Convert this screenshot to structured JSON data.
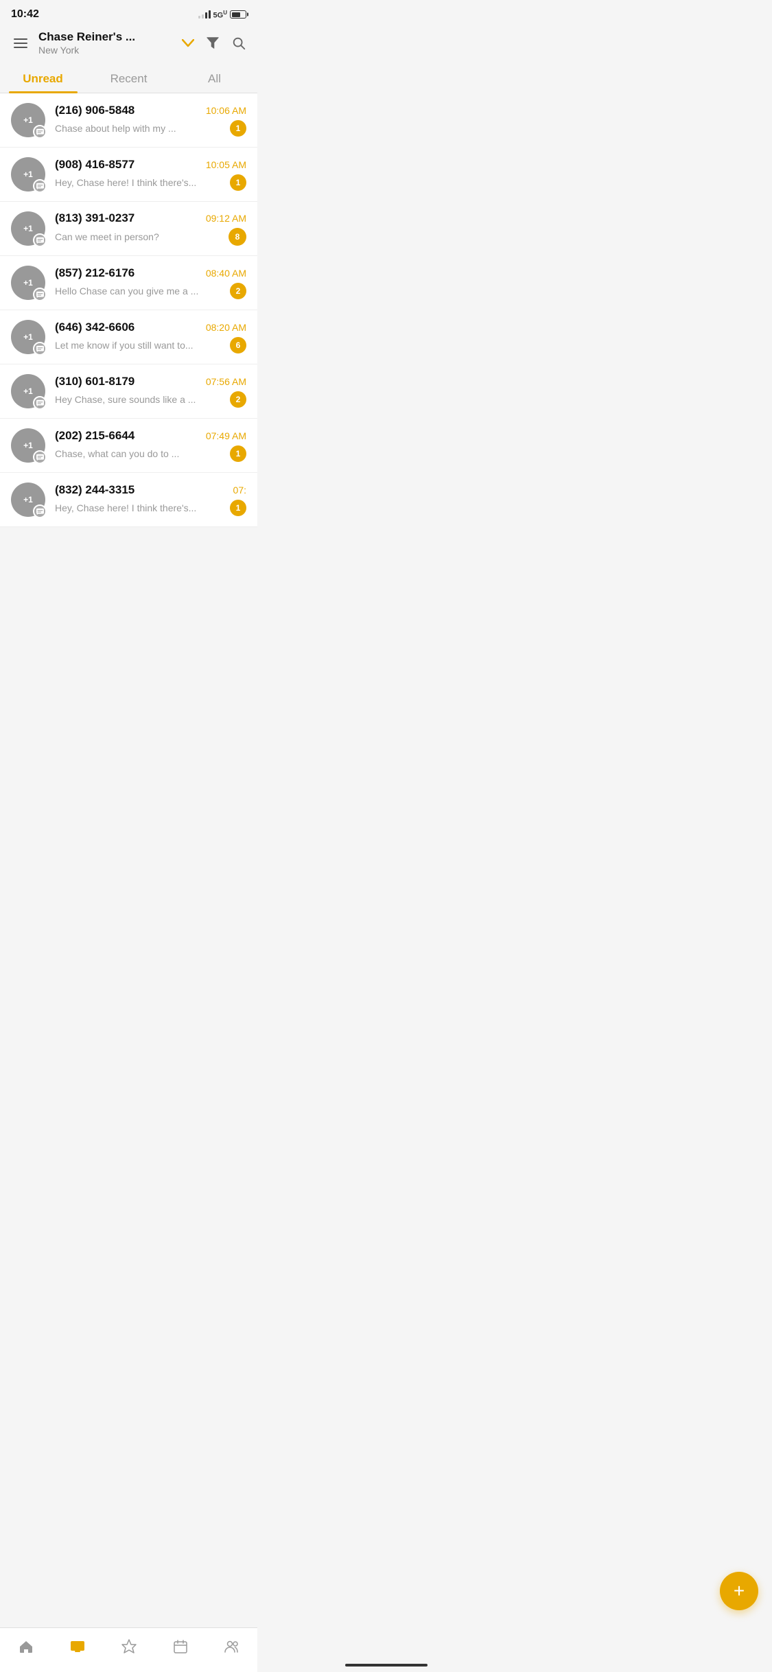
{
  "statusBar": {
    "time": "10:42",
    "network": "5G",
    "networkSuperscript": "U"
  },
  "header": {
    "menuLabel": "menu",
    "title": "Chase Reiner's ...",
    "location": "New York",
    "dropdownLabel": "dropdown",
    "filterLabel": "filter",
    "searchLabel": "search"
  },
  "tabs": [
    {
      "id": "unread",
      "label": "Unread",
      "active": true
    },
    {
      "id": "recent",
      "label": "Recent",
      "active": false
    },
    {
      "id": "all",
      "label": "All",
      "active": false
    }
  ],
  "messages": [
    {
      "id": 1,
      "phone": "(216) 906-5848",
      "time": "10:06 AM",
      "preview": "Chase about help with my ...",
      "unread": 1
    },
    {
      "id": 2,
      "phone": "(908) 416-8577",
      "time": "10:05 AM",
      "preview": "Hey, Chase here! I think there's...",
      "unread": 1
    },
    {
      "id": 3,
      "phone": "(813) 391-0237",
      "time": "09:12 AM",
      "preview": "Can we meet in person?",
      "unread": 8
    },
    {
      "id": 4,
      "phone": "(857) 212-6176",
      "time": "08:40 AM",
      "preview": "Hello Chase can you give me a ...",
      "unread": 2
    },
    {
      "id": 5,
      "phone": "(646) 342-6606",
      "time": "08:20 AM",
      "preview": "Let me know if you still want to...",
      "unread": 6
    },
    {
      "id": 6,
      "phone": "(310) 601-8179",
      "time": "07:56 AM",
      "preview": "Hey Chase, sure sounds like a ...",
      "unread": 2
    },
    {
      "id": 7,
      "phone": "(202) 215-6644",
      "time": "07:49 AM",
      "preview": "Chase, what can you do to ...",
      "unread": 1
    },
    {
      "id": 8,
      "phone": "(832) 244-3315",
      "time": "07:",
      "preview": "Hey, Chase here! I think there's...",
      "unread": 1
    }
  ],
  "fab": {
    "label": "+"
  },
  "bottomNav": [
    {
      "id": "home",
      "label": "home",
      "active": false
    },
    {
      "id": "messages",
      "label": "messages",
      "active": true
    },
    {
      "id": "favorites",
      "label": "favorites",
      "active": false
    },
    {
      "id": "calendar",
      "label": "calendar",
      "active": false
    },
    {
      "id": "contacts",
      "label": "contacts",
      "active": false
    }
  ],
  "avatarLabel": "+1"
}
